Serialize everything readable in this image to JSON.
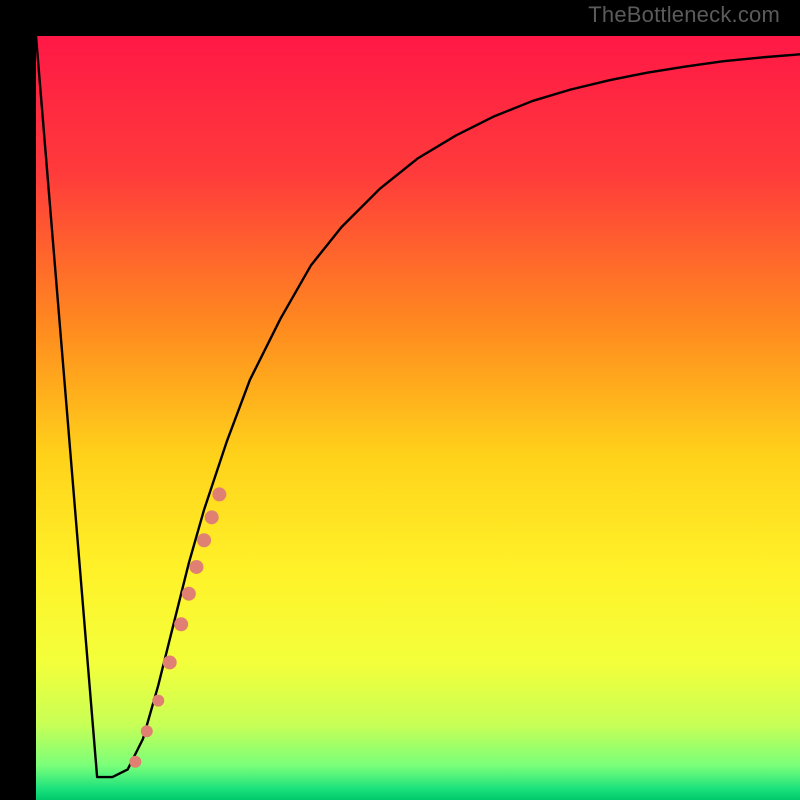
{
  "watermark": "TheBottleneck.com",
  "chart_data": {
    "type": "line",
    "title": "",
    "xlabel": "",
    "ylabel": "",
    "xlim": [
      0,
      100
    ],
    "ylim": [
      0,
      100
    ],
    "grid": false,
    "series": [
      {
        "name": "curve",
        "x": [
          0,
          8,
          10,
          12,
          14,
          16,
          18,
          20,
          22,
          25,
          28,
          32,
          36,
          40,
          45,
          50,
          55,
          60,
          65,
          70,
          75,
          80,
          85,
          90,
          95,
          100
        ],
        "y": [
          100,
          3,
          3,
          4,
          8,
          15,
          23,
          31,
          38,
          47,
          55,
          63,
          70,
          75,
          80,
          84,
          87,
          89.5,
          91.5,
          93,
          94.2,
          95.2,
          96,
          96.7,
          97.2,
          97.6
        ]
      }
    ],
    "marker_points": {
      "comment": "salmon markers along the rising branch",
      "points": [
        {
          "x": 13.0,
          "y": 5.0,
          "r": 6
        },
        {
          "x": 14.5,
          "y": 9.0,
          "r": 6
        },
        {
          "x": 16.0,
          "y": 13.0,
          "r": 6
        },
        {
          "x": 17.5,
          "y": 18.0,
          "r": 7
        },
        {
          "x": 19.0,
          "y": 23.0,
          "r": 7
        },
        {
          "x": 20.0,
          "y": 27.0,
          "r": 7
        },
        {
          "x": 21.0,
          "y": 30.5,
          "r": 7
        },
        {
          "x": 22.0,
          "y": 34.0,
          "r": 7
        },
        {
          "x": 23.0,
          "y": 37.0,
          "r": 7
        },
        {
          "x": 24.0,
          "y": 40.0,
          "r": 7
        }
      ],
      "color": "#e08072"
    },
    "gradient_stops": [
      {
        "pos": 0.0,
        "color": "#ff1846"
      },
      {
        "pos": 0.18,
        "color": "#ff3b3b"
      },
      {
        "pos": 0.38,
        "color": "#ff8a1f"
      },
      {
        "pos": 0.55,
        "color": "#ffd21a"
      },
      {
        "pos": 0.7,
        "color": "#fff229"
      },
      {
        "pos": 0.82,
        "color": "#f3ff3a"
      },
      {
        "pos": 0.9,
        "color": "#c9ff55"
      },
      {
        "pos": 0.955,
        "color": "#7aff7a"
      },
      {
        "pos": 0.985,
        "color": "#1de27d"
      },
      {
        "pos": 1.0,
        "color": "#00c96b"
      }
    ]
  }
}
